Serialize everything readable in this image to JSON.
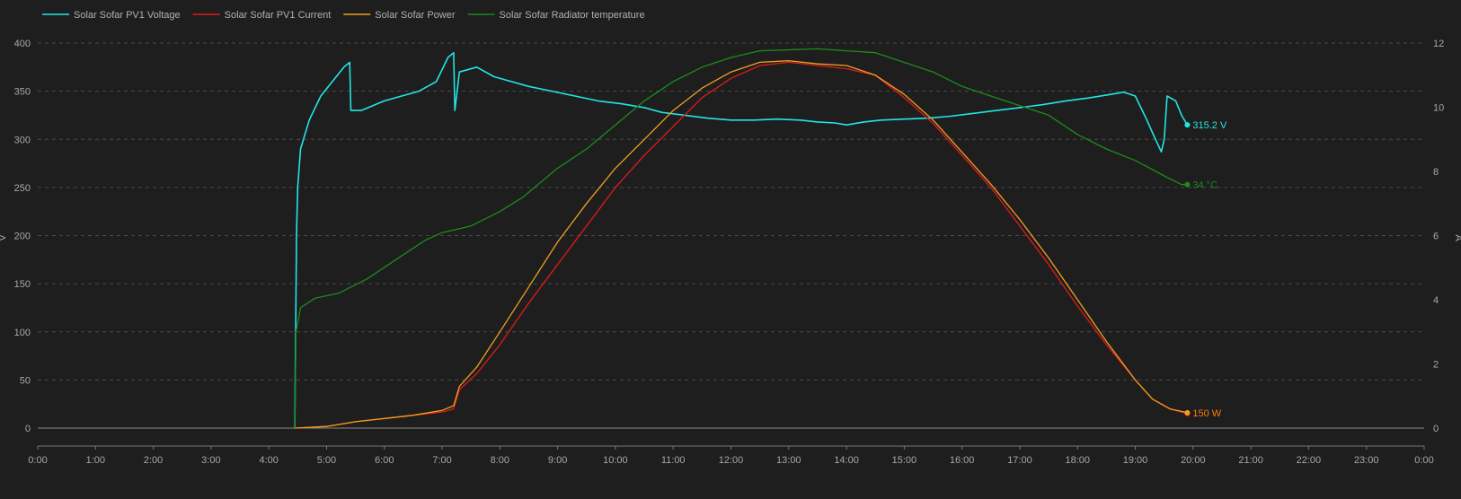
{
  "chart_data": {
    "type": "line",
    "x_axis": {
      "ticks": [
        "0:00",
        "1:00",
        "2:00",
        "3:00",
        "4:00",
        "5:00",
        "6:00",
        "7:00",
        "8:00",
        "9:00",
        "10:00",
        "11:00",
        "12:00",
        "13:00",
        "14:00",
        "15:00",
        "16:00",
        "17:00",
        "18:00",
        "19:00",
        "20:00",
        "21:00",
        "22:00",
        "23:00",
        "0:00"
      ],
      "range_hours": [
        0,
        24
      ]
    },
    "y_left": {
      "label": "V",
      "ticks": [
        0,
        50,
        100,
        150,
        200,
        250,
        300,
        350,
        400
      ],
      "range": [
        0,
        400
      ]
    },
    "y_right": {
      "label": "A",
      "ticks": [
        0,
        2,
        4,
        6,
        8,
        10,
        12
      ],
      "range": [
        0,
        12
      ]
    },
    "grid": true,
    "legend_position": "top-left",
    "series": [
      {
        "name": "Solar Sofar PV1 Voltage",
        "color": "#22e5e5",
        "axis": "left",
        "points": [
          [
            4.45,
            0
          ],
          [
            4.48,
            200
          ],
          [
            4.5,
            250
          ],
          [
            4.55,
            290
          ],
          [
            4.7,
            320
          ],
          [
            4.9,
            345
          ],
          [
            5.1,
            360
          ],
          [
            5.3,
            375
          ],
          [
            5.4,
            380
          ],
          [
            5.42,
            330
          ],
          [
            5.6,
            330
          ],
          [
            5.8,
            335
          ],
          [
            6.0,
            340
          ],
          [
            6.3,
            345
          ],
          [
            6.6,
            350
          ],
          [
            6.9,
            360
          ],
          [
            7.1,
            385
          ],
          [
            7.2,
            390
          ],
          [
            7.22,
            330
          ],
          [
            7.3,
            370
          ],
          [
            7.6,
            375
          ],
          [
            7.9,
            365
          ],
          [
            8.2,
            360
          ],
          [
            8.5,
            355
          ],
          [
            8.9,
            350
          ],
          [
            9.3,
            345
          ],
          [
            9.7,
            340
          ],
          [
            10.1,
            337
          ],
          [
            10.5,
            333
          ],
          [
            10.8,
            328
          ],
          [
            11.2,
            325
          ],
          [
            11.6,
            322
          ],
          [
            12.0,
            320
          ],
          [
            12.4,
            320
          ],
          [
            12.8,
            321
          ],
          [
            13.2,
            320
          ],
          [
            13.5,
            318
          ],
          [
            13.8,
            317
          ],
          [
            14.0,
            315
          ],
          [
            14.3,
            318
          ],
          [
            14.6,
            320
          ],
          [
            15.0,
            321
          ],
          [
            15.4,
            322
          ],
          [
            15.8,
            324
          ],
          [
            16.2,
            327
          ],
          [
            16.6,
            330
          ],
          [
            17.0,
            333
          ],
          [
            17.4,
            336
          ],
          [
            17.8,
            340
          ],
          [
            18.2,
            343
          ],
          [
            18.5,
            346
          ],
          [
            18.8,
            349
          ],
          [
            19.0,
            345
          ],
          [
            19.2,
            320
          ],
          [
            19.35,
            300
          ],
          [
            19.45,
            287
          ],
          [
            19.5,
            300
          ],
          [
            19.55,
            345
          ],
          [
            19.7,
            340
          ],
          [
            19.8,
            325
          ],
          [
            19.9,
            315
          ]
        ]
      },
      {
        "name": "Solar Sofar PV1 Current",
        "color": "#e11a1a",
        "axis": "right",
        "points": [
          [
            4.45,
            0
          ],
          [
            5.0,
            0.05
          ],
          [
            5.5,
            0.2
          ],
          [
            6.0,
            0.3
          ],
          [
            6.5,
            0.4
          ],
          [
            7.0,
            0.5
          ],
          [
            7.2,
            0.6
          ],
          [
            7.3,
            1.2
          ],
          [
            7.6,
            1.7
          ],
          [
            8.0,
            2.6
          ],
          [
            8.5,
            3.9
          ],
          [
            9.0,
            5.1
          ],
          [
            9.5,
            6.3
          ],
          [
            10.0,
            7.5
          ],
          [
            10.5,
            8.5
          ],
          [
            11.0,
            9.4
          ],
          [
            11.5,
            10.3
          ],
          [
            12.0,
            10.9
          ],
          [
            12.5,
            11.3
          ],
          [
            13.0,
            11.4
          ],
          [
            13.5,
            11.3
          ],
          [
            14.0,
            11.2
          ],
          [
            14.5,
            11.0
          ],
          [
            15.0,
            10.3
          ],
          [
            15.5,
            9.5
          ],
          [
            16.0,
            8.5
          ],
          [
            16.5,
            7.5
          ],
          [
            17.0,
            6.3
          ],
          [
            17.5,
            5.1
          ],
          [
            18.0,
            3.8
          ],
          [
            18.5,
            2.6
          ],
          [
            19.0,
            1.5
          ],
          [
            19.3,
            0.9
          ],
          [
            19.6,
            0.6
          ],
          [
            19.9,
            0.45
          ]
        ]
      },
      {
        "name": "Solar Sofar Power",
        "color": "#f0a020",
        "axis": "right",
        "points": [
          [
            4.45,
            0
          ],
          [
            5.0,
            0.05
          ],
          [
            5.5,
            0.2
          ],
          [
            6.0,
            0.3
          ],
          [
            6.5,
            0.4
          ],
          [
            7.0,
            0.55
          ],
          [
            7.2,
            0.7
          ],
          [
            7.3,
            1.3
          ],
          [
            7.6,
            1.9
          ],
          [
            8.0,
            3.0
          ],
          [
            8.5,
            4.4
          ],
          [
            9.0,
            5.8
          ],
          [
            9.5,
            7.0
          ],
          [
            10.0,
            8.1
          ],
          [
            10.5,
            9.0
          ],
          [
            11.0,
            9.9
          ],
          [
            11.5,
            10.6
          ],
          [
            12.0,
            11.1
          ],
          [
            12.5,
            11.4
          ],
          [
            13.0,
            11.45
          ],
          [
            13.5,
            11.35
          ],
          [
            14.0,
            11.3
          ],
          [
            14.5,
            11.0
          ],
          [
            15.0,
            10.4
          ],
          [
            15.5,
            9.6
          ],
          [
            16.0,
            8.6
          ],
          [
            16.5,
            7.6
          ],
          [
            17.0,
            6.5
          ],
          [
            17.5,
            5.3
          ],
          [
            18.0,
            4.0
          ],
          [
            18.5,
            2.7
          ],
          [
            19.0,
            1.5
          ],
          [
            19.3,
            0.9
          ],
          [
            19.6,
            0.6
          ],
          [
            19.9,
            0.48
          ]
        ]
      },
      {
        "name": "Solar Sofar Radiator temperature",
        "color": "#1c8c1c",
        "axis": "left",
        "points": [
          [
            4.45,
            0
          ],
          [
            4.47,
            100
          ],
          [
            4.55,
            125
          ],
          [
            4.8,
            135
          ],
          [
            5.2,
            140
          ],
          [
            5.7,
            155
          ],
          [
            6.2,
            175
          ],
          [
            6.7,
            195
          ],
          [
            7.0,
            203
          ],
          [
            7.5,
            210
          ],
          [
            8.0,
            225
          ],
          [
            8.4,
            240
          ],
          [
            8.7,
            255
          ],
          [
            9.0,
            270
          ],
          [
            9.5,
            290
          ],
          [
            10.0,
            315
          ],
          [
            10.5,
            340
          ],
          [
            11.0,
            360
          ],
          [
            11.5,
            375
          ],
          [
            12.0,
            385
          ],
          [
            12.5,
            392
          ],
          [
            13.0,
            393
          ],
          [
            13.5,
            394
          ],
          [
            14.0,
            392
          ],
          [
            14.5,
            390
          ],
          [
            15.0,
            380
          ],
          [
            15.5,
            370
          ],
          [
            16.0,
            355
          ],
          [
            16.5,
            345
          ],
          [
            17.0,
            335
          ],
          [
            17.5,
            325
          ],
          [
            18.0,
            305
          ],
          [
            18.5,
            290
          ],
          [
            19.0,
            278
          ],
          [
            19.5,
            262
          ],
          [
            19.8,
            253
          ],
          [
            19.9,
            253
          ]
        ]
      }
    ],
    "end_labels": [
      {
        "text": "315.2 V",
        "color": "#22e5e5",
        "series": "Solar Sofar PV1 Voltage"
      },
      {
        "text": "34 °C",
        "color": "#1c8c1c",
        "series": "Solar Sofar Radiator temperature"
      },
      {
        "text": "150 W",
        "color": "#ff7a00",
        "series": "Solar Sofar Power"
      }
    ]
  }
}
